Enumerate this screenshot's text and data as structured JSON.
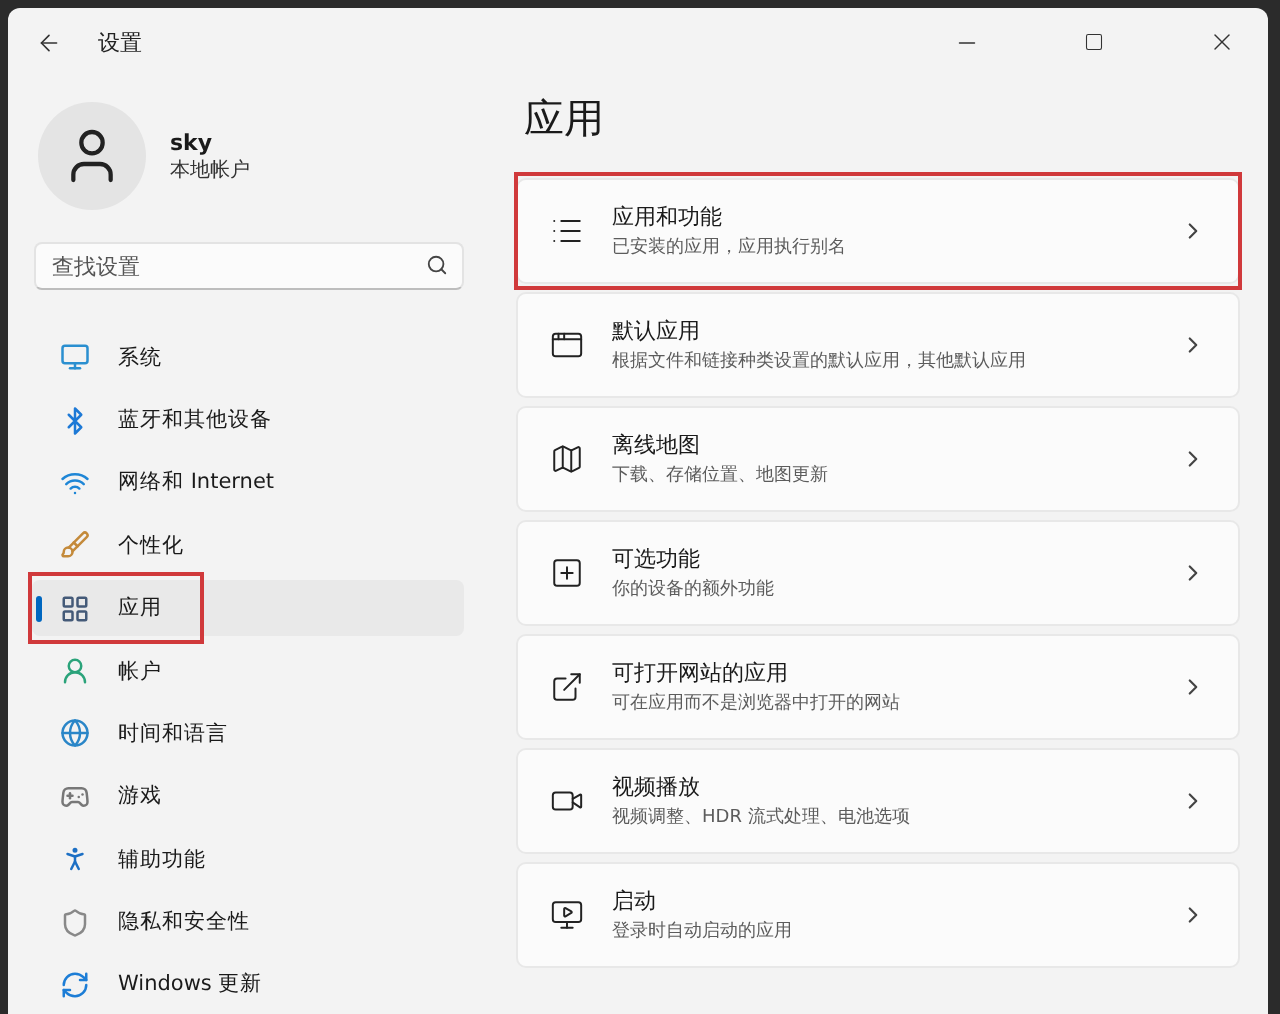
{
  "window": {
    "title": "设置"
  },
  "account": {
    "name": "sky",
    "type": "本地帐户"
  },
  "search": {
    "placeholder": "查找设置"
  },
  "sidebar": {
    "items": [
      {
        "kind": "system",
        "label": "系统",
        "selected": false,
        "annotated": false
      },
      {
        "kind": "bluetooth",
        "label": "蓝牙和其他设备",
        "selected": false,
        "annotated": false
      },
      {
        "kind": "network",
        "label": "网络和 Internet",
        "selected": false,
        "annotated": false
      },
      {
        "kind": "personalization",
        "label": "个性化",
        "selected": false,
        "annotated": false
      },
      {
        "kind": "apps",
        "label": "应用",
        "selected": true,
        "annotated": true
      },
      {
        "kind": "account",
        "label": "帐户",
        "selected": false,
        "annotated": false
      },
      {
        "kind": "time",
        "label": "时间和语言",
        "selected": false,
        "annotated": false
      },
      {
        "kind": "game",
        "label": "游戏",
        "selected": false,
        "annotated": false
      },
      {
        "kind": "accessibility",
        "label": "辅助功能",
        "selected": false,
        "annotated": false
      },
      {
        "kind": "privacy",
        "label": "隐私和安全性",
        "selected": false,
        "annotated": false
      },
      {
        "kind": "update",
        "label": "Windows 更新",
        "selected": false,
        "annotated": false
      }
    ]
  },
  "page": {
    "title": "应用",
    "cards": [
      {
        "kind": "features",
        "title": "应用和功能",
        "subtitle": "已安装的应用，应用执行别名",
        "annotated": true
      },
      {
        "kind": "default",
        "title": "默认应用",
        "subtitle": "根据文件和链接种类设置的默认应用，其他默认应用",
        "annotated": false
      },
      {
        "kind": "map",
        "title": "离线地图",
        "subtitle": "下载、存储位置、地图更新",
        "annotated": false
      },
      {
        "kind": "optional",
        "title": "可选功能",
        "subtitle": "你的设备的额外功能",
        "annotated": false
      },
      {
        "kind": "website",
        "title": "可打开网站的应用",
        "subtitle": "可在应用而不是浏览器中打开的网站",
        "annotated": false
      },
      {
        "kind": "video",
        "title": "视频播放",
        "subtitle": "视频调整、HDR 流式处理、电池选项",
        "annotated": false
      },
      {
        "kind": "startup",
        "title": "启动",
        "subtitle": "登录时自动启动的应用",
        "annotated": false
      }
    ]
  }
}
